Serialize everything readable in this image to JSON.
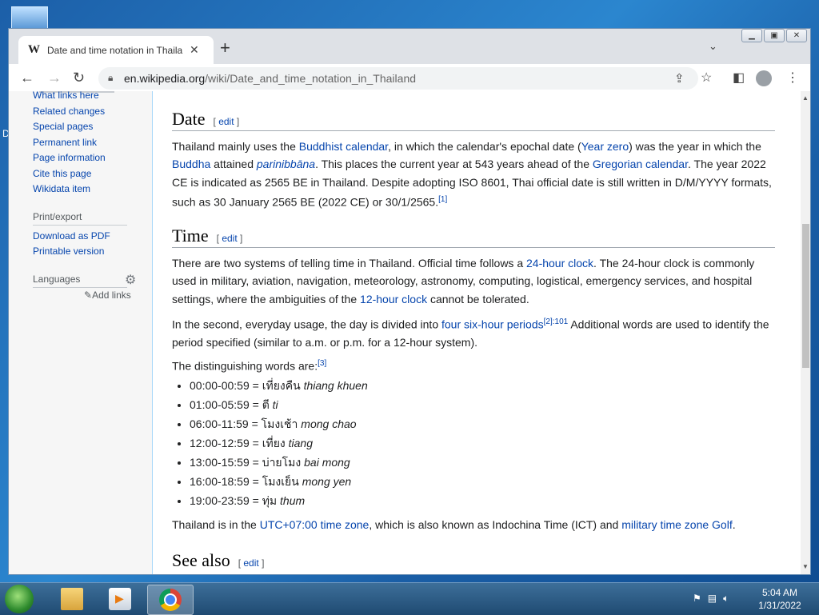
{
  "browser": {
    "tab_title": "Date and time notation in Thaila",
    "tab_favicon": "W",
    "url_host": "en.wikipedia.org",
    "url_path": "/wiki/Date_and_time_notation_in_Thailand"
  },
  "sidebar": {
    "tools": [
      "What links here",
      "Related changes",
      "Special pages",
      "Permanent link",
      "Page information",
      "Cite this page",
      "Wikidata item"
    ],
    "print_heading": "Print/export",
    "print_items": [
      "Download as PDF",
      "Printable version"
    ],
    "languages_heading": "Languages",
    "add_links": "Add links"
  },
  "article": {
    "edit_label": "edit",
    "date_heading": "Date",
    "date_para": {
      "t1": "Thailand mainly uses the ",
      "l1": "Buddhist calendar",
      "t2": ", in which the calendar's epochal date (",
      "l2": "Year zero",
      "t3": ") was the year in which the ",
      "l3": "Buddha",
      "t4": " attained ",
      "l4": "parinibbāna",
      "t5": ". This places the current year at 543 years ahead of the ",
      "l5": "Gregorian calendar",
      "t6": ". The year 2022 CE is indicated as 2565 BE in Thailand. Despite adopting ISO 8601, Thai official date is still written in D/M/YYYY formats, such as 30 January 2565 BE (2022 CE) or 30/1/2565.",
      "ref": "[1]"
    },
    "time_heading": "Time",
    "time_para1": {
      "t1": "There are two systems of telling time in Thailand. Official time follows a ",
      "l1": "24-hour clock",
      "t2": ". The 24-hour clock is commonly used in military, aviation, navigation, meteorology, astronomy, computing, logistical, emergency services, and hospital settings, where the ambiguities of the ",
      "l2": "12-hour clock",
      "t3": " cannot be tolerated."
    },
    "time_para2": {
      "t1": "In the second, everyday usage, the day is divided into ",
      "l1": "four six-hour periods",
      "ref": "[2]:101",
      "t2": " Additional words are used to identify the period specified (similar to a.m. or p.m. for a 12-hour system)."
    },
    "time_para3": {
      "t1": "The distinguishing words are:",
      "ref": "[3]"
    },
    "periods": [
      {
        "range": "00:00-00:59 = ",
        "thai": "เที่ยงคืน ",
        "roman": "thiang khuen"
      },
      {
        "range": "01:00-05:59 = ",
        "thai": "ตี ",
        "roman": "ti"
      },
      {
        "range": "06:00-11:59 = ",
        "thai": "โมงเช้า ",
        "roman": "mong chao"
      },
      {
        "range": "12:00-12:59 = ",
        "thai": "เที่ยง ",
        "roman": "tiang"
      },
      {
        "range": "13:00-15:59 = ",
        "thai": "บ่ายโมง ",
        "roman": "bai mong"
      },
      {
        "range": "16:00-18:59 = ",
        "thai": "โมงเย็น ",
        "roman": "mong yen"
      },
      {
        "range": "19:00-23:59 = ",
        "thai": "ทุ่ม ",
        "roman": "thum"
      }
    ],
    "time_para4": {
      "t1": "Thailand is in the ",
      "l1": "UTC+07:00 time zone",
      "t2": ", which is also known as Indochina Time (ICT) and ",
      "l2": "military time zone Golf",
      "t3": "."
    },
    "see_also_heading": "See also"
  },
  "taskbar": {
    "time": "5:04 AM",
    "date": "1/31/2022"
  }
}
